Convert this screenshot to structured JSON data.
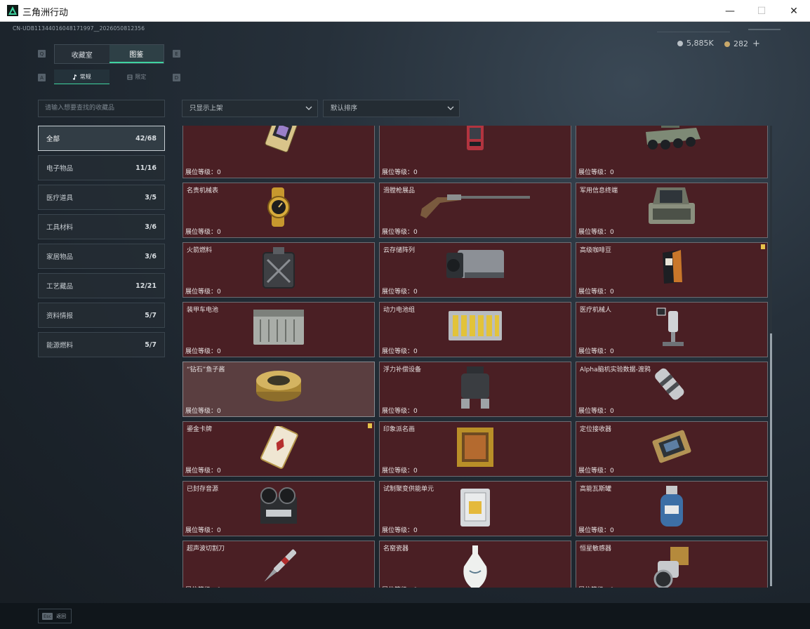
{
  "window": {
    "title": "三角洲行动",
    "minimize_glyph": "—",
    "maximize_glyph": "☐",
    "close_glyph": "✕"
  },
  "uid": "CN-UDB11344016048171997__2026050812356",
  "currency": {
    "coins": "5,885K",
    "tokens": "282",
    "add": "+"
  },
  "key_hints": {
    "q": "Q",
    "e": "E",
    "a": "A",
    "d": "D"
  },
  "main_tabs": [
    {
      "label": "收藏室"
    },
    {
      "label": "图鉴"
    }
  ],
  "sub_tabs": [
    {
      "label": "常规"
    },
    {
      "label": "限定"
    }
  ],
  "search": {
    "placeholder": "请输入想要查找的收藏品"
  },
  "filters": {
    "shelf": "只显示上架",
    "sort": "默认排序"
  },
  "categories": [
    {
      "label": "全部",
      "count": "42/68"
    },
    {
      "label": "电子物品",
      "count": "11/16"
    },
    {
      "label": "医疗道具",
      "count": "3/5"
    },
    {
      "label": "工具材料",
      "count": "3/6"
    },
    {
      "label": "家居物品",
      "count": "3/6"
    },
    {
      "label": "工艺藏品",
      "count": "12/21"
    },
    {
      "label": "资料情报",
      "count": "5/7"
    },
    {
      "label": "能源燃料",
      "count": "5/7"
    }
  ],
  "level_label": "展位等级：0",
  "items": [
    {
      "name": "",
      "icon": "gold-card-icon"
    },
    {
      "name": "",
      "icon": "red-device-icon"
    },
    {
      "name": "",
      "icon": "armored-vehicle-icon"
    },
    {
      "name": "名贵机械表",
      "icon": "gold-watch-icon"
    },
    {
      "name": "滑膛枪展品",
      "icon": "musket-icon"
    },
    {
      "name": "军用信息终端",
      "icon": "military-terminal-icon"
    },
    {
      "name": "火箭燃料",
      "icon": "fuel-canister-icon"
    },
    {
      "name": "云存储阵列",
      "icon": "storage-array-icon"
    },
    {
      "name": "高级咖啡豆",
      "icon": "coffee-beans-icon",
      "flag": true
    },
    {
      "name": "装甲车电池",
      "icon": "vehicle-battery-icon"
    },
    {
      "name": "动力电池组",
      "icon": "battery-pack-icon"
    },
    {
      "name": "医疗机械人",
      "icon": "medical-robot-icon"
    },
    {
      "name": "“钻石”鱼子酱",
      "icon": "caviar-tin-icon",
      "highlight": true
    },
    {
      "name": "浮力补偿设备",
      "icon": "buoyancy-device-icon"
    },
    {
      "name": "Alpha脑机实验数据-渡鸦",
      "icon": "data-capsule-icon"
    },
    {
      "name": "鎏金卡牌",
      "icon": "gilded-card-icon",
      "flag": true
    },
    {
      "name": "印象派名画",
      "icon": "framed-painting-icon"
    },
    {
      "name": "定位接收器",
      "icon": "locator-receiver-icon"
    },
    {
      "name": "已封存音源",
      "icon": "reel-recorder-icon"
    },
    {
      "name": "试制聚变供能单元",
      "icon": "fusion-cell-icon"
    },
    {
      "name": "高能瓦斯罐",
      "icon": "gas-tank-icon"
    },
    {
      "name": "超声波切割刀",
      "icon": "ultrasonic-knife-icon"
    },
    {
      "name": "名窑瓷器",
      "icon": "porcelain-vase-icon"
    },
    {
      "name": "恒星敏感器",
      "icon": "star-sensor-icon"
    }
  ],
  "footer": {
    "esc_key": "Esc",
    "esc_label": "返回"
  }
}
